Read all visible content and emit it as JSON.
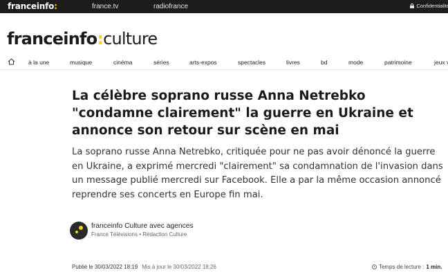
{
  "topbar": {
    "brand_main": "franceinfo",
    "brand_suffix": ":",
    "links": [
      "france.tv",
      "radiofrance"
    ],
    "privacy_label": "Confidentialité"
  },
  "logo": {
    "part1": "franceinfo",
    "part2": ":",
    "part3": "culture"
  },
  "nav": {
    "items": [
      "à la une",
      "musique",
      "cinéma",
      "séries",
      "arts-expos",
      "spectacles",
      "livres",
      "bd",
      "mode",
      "patrimoine",
      "jeux v"
    ]
  },
  "article": {
    "headline": "La célèbre soprano russe Anna Netrebko \"condamne clairement\" la guerre en Ukraine et annonce son retour sur scène en mai",
    "lede": "La soprano russe Anna Netrebko, critiquée pour ne pas avoir dénoncé la guerre en Ukraine, a exprimé mercredi \"clairement\" sa condamnation de l'invasion dans un message publié mercredi sur Facebook. Elle a par la même occasion annoncé reprendre ses concerts en Europe fin mai.",
    "author": "franceinfo Culture avec agences",
    "author_org": "France Télévisions • Rédaction Culture",
    "published": "Publié le 30/03/2022 18:19",
    "updated": "Mis à jour le 30/03/2022 18:26",
    "read_time_label": "Temps de lecture :",
    "read_time_value": "1 min."
  },
  "colors": {
    "accent": "#fcd200",
    "topbar_bg": "#1c1c1c"
  }
}
